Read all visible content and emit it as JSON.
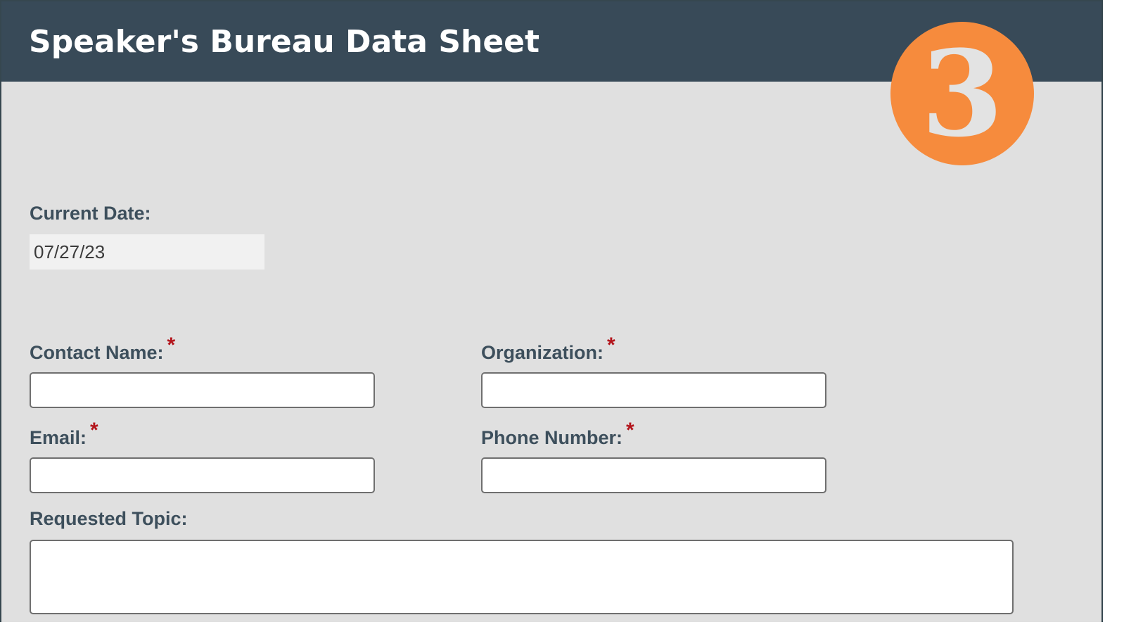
{
  "header": {
    "title": "Speaker's Bureau Data Sheet",
    "badge_number": "3"
  },
  "form": {
    "current_date": {
      "label": "Current Date:",
      "value": "07/27/23"
    },
    "contact_name": {
      "label": "Contact Name:",
      "required_mark": "*",
      "value": ""
    },
    "organization": {
      "label": "Organization:",
      "required_mark": "*",
      "value": ""
    },
    "email": {
      "label": "Email:",
      "required_mark": "*",
      "value": ""
    },
    "phone_number": {
      "label": "Phone Number:",
      "required_mark": "*",
      "value": ""
    },
    "requested_topic": {
      "label": "Requested Topic:",
      "value": ""
    }
  },
  "colors": {
    "header_bg": "#384a58",
    "page_bg": "#e0e0e0",
    "badge": "#f68b3d",
    "required": "#b3141b",
    "label_text": "#3d4f5c"
  }
}
